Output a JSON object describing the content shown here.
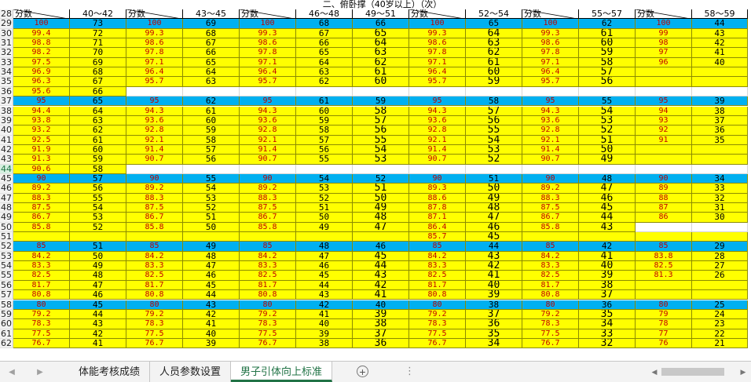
{
  "sheet_title": "二、俯卧撑（40岁以上）（次）",
  "header": {
    "row_label": "28",
    "cells": [
      "分数",
      "40～42",
      "分数",
      "43～45",
      "分数",
      "46～48",
      "49～51",
      "分数",
      "52～54",
      "分数",
      "55～57",
      "分数",
      "58～59"
    ]
  },
  "rows": [
    {
      "n": "29",
      "blue": true,
      "v": [
        "100",
        "73",
        "100",
        "69",
        "100",
        "68",
        "66",
        "100",
        "65",
        "100",
        "62",
        "100",
        "44"
      ]
    },
    {
      "n": "30",
      "v": [
        "99.4",
        "72",
        "99.3",
        "68",
        "99.3",
        "67",
        "65",
        "99.3",
        "64",
        "99.3",
        "61",
        "99",
        "43"
      ]
    },
    {
      "n": "31",
      "v": [
        "98.8",
        "71",
        "98.6",
        "67",
        "98.6",
        "66",
        "64",
        "98.6",
        "63",
        "98.6",
        "60",
        "98",
        "42"
      ]
    },
    {
      "n": "32",
      "v": [
        "98.2",
        "70",
        "97.8",
        "66",
        "97.8",
        "65",
        "63",
        "97.8",
        "62",
        "97.8",
        "59",
        "97",
        "41"
      ]
    },
    {
      "n": "33",
      "v": [
        "97.5",
        "69",
        "97.1",
        "65",
        "97.1",
        "64",
        "62",
        "97.1",
        "61",
        "97.1",
        "58",
        "96",
        "40"
      ]
    },
    {
      "n": "34",
      "v": [
        "96.9",
        "68",
        "96.4",
        "64",
        "96.4",
        "63",
        "61",
        "96.4",
        "60",
        "96.4",
        "57",
        "",
        ""
      ]
    },
    {
      "n": "35",
      "v": [
        "96.3",
        "67",
        "95.7",
        "63",
        "95.7",
        "62",
        "60",
        "95.7",
        "59",
        "95.7",
        "56",
        "",
        ""
      ]
    },
    {
      "n": "36",
      "v": [
        "95.6",
        "66",
        "",
        "",
        "",
        "",
        "",
        "",
        "",
        "",
        "",
        "",
        ""
      ]
    },
    {
      "n": "37",
      "blue": true,
      "v": [
        "95",
        "65",
        "95",
        "62",
        "95",
        "61",
        "59",
        "95",
        "58",
        "95",
        "55",
        "95",
        "39"
      ]
    },
    {
      "n": "38",
      "v": [
        "94.4",
        "64",
        "94.3",
        "61",
        "94.3",
        "60",
        "58",
        "94.3",
        "57",
        "94.3",
        "54",
        "94",
        "38"
      ]
    },
    {
      "n": "39",
      "v": [
        "93.8",
        "63",
        "93.6",
        "60",
        "93.6",
        "59",
        "57",
        "93.6",
        "56",
        "93.6",
        "53",
        "93",
        "37"
      ]
    },
    {
      "n": "40",
      "v": [
        "93.2",
        "62",
        "92.8",
        "59",
        "92.8",
        "58",
        "56",
        "92.8",
        "55",
        "92.8",
        "52",
        "92",
        "36"
      ]
    },
    {
      "n": "41",
      "v": [
        "92.5",
        "61",
        "92.1",
        "58",
        "92.1",
        "57",
        "55",
        "92.1",
        "54",
        "92.1",
        "51",
        "91",
        "35"
      ]
    },
    {
      "n": "42",
      "v": [
        "91.9",
        "60",
        "91.4",
        "57",
        "91.4",
        "56",
        "54",
        "91.4",
        "53",
        "91.4",
        "50",
        "",
        ""
      ]
    },
    {
      "n": "43",
      "v": [
        "91.3",
        "59",
        "90.7",
        "56",
        "90.7",
        "55",
        "53",
        "90.7",
        "52",
        "90.7",
        "49",
        "",
        ""
      ]
    },
    {
      "n": "44",
      "sel": true,
      "v": [
        "90.6",
        "58",
        "",
        "",
        "",
        "",
        "",
        "",
        "",
        "",
        "",
        "",
        ""
      ]
    },
    {
      "n": "45",
      "blue": true,
      "v": [
        "90",
        "57",
        "90",
        "55",
        "90",
        "54",
        "52",
        "90",
        "51",
        "90",
        "48",
        "90",
        "34"
      ]
    },
    {
      "n": "46",
      "v": [
        "89.2",
        "56",
        "89.2",
        "54",
        "89.2",
        "53",
        "51",
        "89.3",
        "50",
        "89.2",
        "47",
        "89",
        "33"
      ]
    },
    {
      "n": "47",
      "v": [
        "88.3",
        "55",
        "88.3",
        "53",
        "88.3",
        "52",
        "50",
        "88.6",
        "49",
        "88.3",
        "46",
        "88",
        "32"
      ]
    },
    {
      "n": "48",
      "v": [
        "87.5",
        "54",
        "87.5",
        "52",
        "87.5",
        "51",
        "49",
        "87.8",
        "48",
        "87.5",
        "45",
        "87",
        "31"
      ]
    },
    {
      "n": "49",
      "v": [
        "86.7",
        "53",
        "86.7",
        "51",
        "86.7",
        "50",
        "48",
        "87.1",
        "47",
        "86.7",
        "44",
        "86",
        "30"
      ]
    },
    {
      "n": "50",
      "v": [
        "85.8",
        "52",
        "85.8",
        "50",
        "85.8",
        "49",
        "47",
        "86.4",
        "46",
        "85.8",
        "43",
        "",
        ""
      ]
    },
    {
      "n": "51",
      "v": [
        "",
        "",
        "",
        "",
        "",
        "",
        "",
        "85.7",
        "45",
        "",
        "",
        "",
        ""
      ]
    },
    {
      "n": "52",
      "blue": true,
      "v": [
        "85",
        "51",
        "85",
        "49",
        "85",
        "48",
        "46",
        "85",
        "44",
        "85",
        "42",
        "85",
        "29"
      ]
    },
    {
      "n": "53",
      "v": [
        "84.2",
        "50",
        "84.2",
        "48",
        "84.2",
        "47",
        "45",
        "84.2",
        "43",
        "84.2",
        "41",
        "83.8",
        "28"
      ]
    },
    {
      "n": "54",
      "v": [
        "83.3",
        "49",
        "83.3",
        "47",
        "83.3",
        "46",
        "44",
        "83.3",
        "42",
        "83.3",
        "40",
        "82.5",
        "27"
      ]
    },
    {
      "n": "55",
      "v": [
        "82.5",
        "48",
        "82.5",
        "46",
        "82.5",
        "45",
        "43",
        "82.5",
        "41",
        "82.5",
        "39",
        "81.3",
        "26"
      ]
    },
    {
      "n": "56",
      "v": [
        "81.7",
        "47",
        "81.7",
        "45",
        "81.7",
        "44",
        "42",
        "81.7",
        "40",
        "81.7",
        "38",
        "",
        ""
      ]
    },
    {
      "n": "57",
      "v": [
        "80.8",
        "46",
        "80.8",
        "44",
        "80.8",
        "43",
        "41",
        "80.8",
        "39",
        "80.8",
        "37",
        "",
        ""
      ]
    },
    {
      "n": "58",
      "blue": true,
      "v": [
        "80",
        "45",
        "80",
        "43",
        "80",
        "42",
        "40",
        "80",
        "38",
        "80",
        "36",
        "80",
        "25"
      ]
    },
    {
      "n": "59",
      "v": [
        "79.2",
        "44",
        "79.2",
        "42",
        "79.2",
        "41",
        "39",
        "79.2",
        "37",
        "79.2",
        "35",
        "79",
        "24"
      ]
    },
    {
      "n": "60",
      "v": [
        "78.3",
        "43",
        "78.3",
        "41",
        "78.3",
        "40",
        "38",
        "78.3",
        "36",
        "78.3",
        "34",
        "78",
        "23"
      ]
    },
    {
      "n": "61",
      "v": [
        "77.5",
        "42",
        "77.5",
        "40",
        "77.5",
        "39",
        "37",
        "77.5",
        "35",
        "77.5",
        "33",
        "77",
        "22"
      ]
    },
    {
      "n": "62",
      "v": [
        "76.7",
        "41",
        "76.7",
        "39",
        "76.7",
        "38",
        "36",
        "76.7",
        "34",
        "76.7",
        "32",
        "76",
        "21"
      ]
    }
  ],
  "tabs": [
    "体能考核成绩",
    "人员参数设置",
    "男子引体向上标准"
  ],
  "active_tab": 2,
  "colors": {
    "score_text": "#c00000",
    "band_row": "#00b0f0",
    "data_fill": "#ffff00",
    "active_tab": "#217346"
  }
}
